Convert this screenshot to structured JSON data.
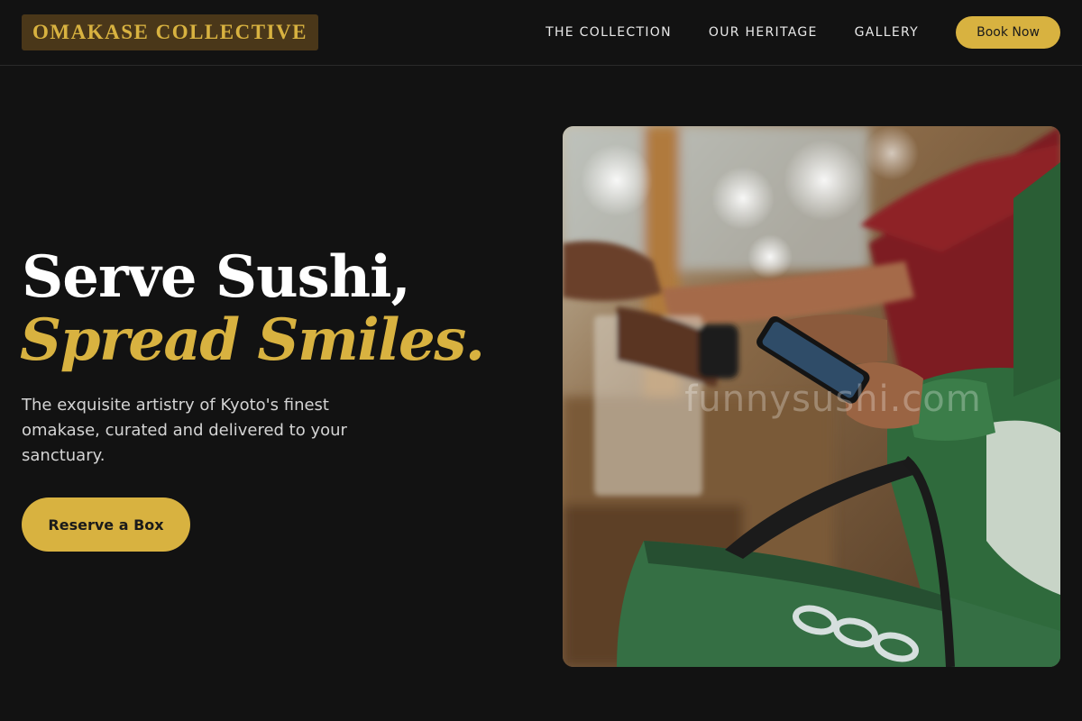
{
  "header": {
    "brand": "OMAKASE COLLECTIVE",
    "nav": [
      {
        "label": "THE COLLECTION"
      },
      {
        "label": "OUR HERITAGE"
      },
      {
        "label": "GALLERY"
      }
    ],
    "book_label": "Book Now"
  },
  "hero": {
    "title_line1": "Serve Sushi,",
    "title_line2": "Spread Smiles.",
    "description": "The exquisite artistry of Kyoto's finest omakase, curated and delivered to your sanctuary.",
    "cta_label": "Reserve a Box",
    "image": {
      "subject": "delivery courier in green jacket checking a smartphone while receiving a packaged order",
      "watermark": "funnysushi.com"
    }
  },
  "colors": {
    "background": "#121212",
    "accent_gold": "#d8b240",
    "brand_bg": "#4a3719",
    "text_light": "#ffffff",
    "text_muted": "#d4d4d4"
  }
}
